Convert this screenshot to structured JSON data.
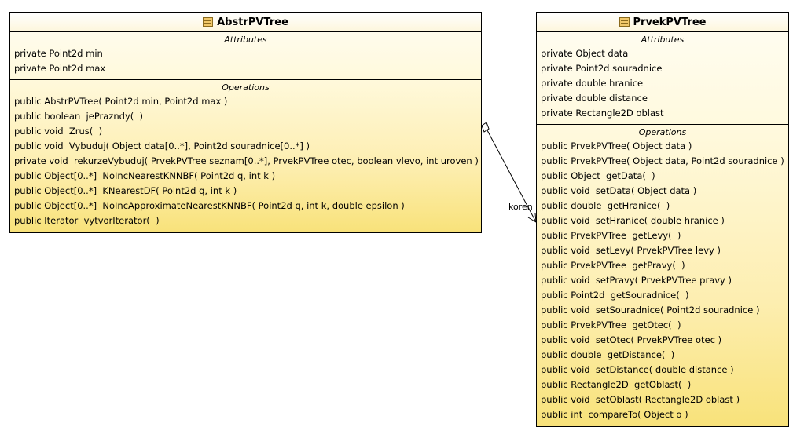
{
  "classes": [
    {
      "name": "AbstrPVTree",
      "attributes_title": "Attributes",
      "operations_title": "Operations",
      "attributes": [
        "private Point2d min",
        "private Point2d max"
      ],
      "operations": [
        "public AbstrPVTree( Point2d min, Point2d max )",
        "public boolean  jePrazndy(  )",
        "public void  Zrus(  )",
        "public void  Vybuduj( Object data[0..*], Point2d souradnice[0..*] )",
        "private void  rekurzeVybuduj( PrvekPVTree seznam[0..*], PrvekPVTree otec, boolean vlevo, int uroven )",
        "public Object[0..*]  NoIncNearestKNNBF( Point2d q, int k )",
        "public Object[0..*]  KNearestDF( Point2d q, int k )",
        "public Object[0..*]  NoIncApproximateNearestKNNBF( Point2d q, int k, double epsilon )",
        "public Iterator  vytvorIterator(  )"
      ]
    },
    {
      "name": "PrvekPVTree",
      "attributes_title": "Attributes",
      "operations_title": "Operations",
      "attributes": [
        "private Object data",
        "private Point2d souradnice",
        "private double hranice",
        "private double distance",
        "private Rectangle2D oblast"
      ],
      "operations": [
        "public PrvekPVTree( Object data )",
        "public PrvekPVTree( Object data, Point2d souradnice )",
        "public Object  getData(  )",
        "public void  setData( Object data )",
        "public double  getHranice(  )",
        "public void  setHranice( double hranice )",
        "public PrvekPVTree  getLevy(  )",
        "public void  setLevy( PrvekPVTree levy )",
        "public PrvekPVTree  getPravy(  )",
        "public void  setPravy( PrvekPVTree pravy )",
        "public Point2d  getSouradnice(  )",
        "public void  setSouradnice( Point2d souradnice )",
        "public PrvekPVTree  getOtec(  )",
        "public void  setOtec( PrvekPVTree otec )",
        "public double  getDistance(  )",
        "public void  setDistance( double distance )",
        "public Rectangle2D  getOblast(  )",
        "public void  setOblast( Rectangle2D oblast )",
        "public int  compareTo( Object o )"
      ]
    }
  ],
  "association": {
    "role_label": "koren",
    "type": "aggregation"
  }
}
